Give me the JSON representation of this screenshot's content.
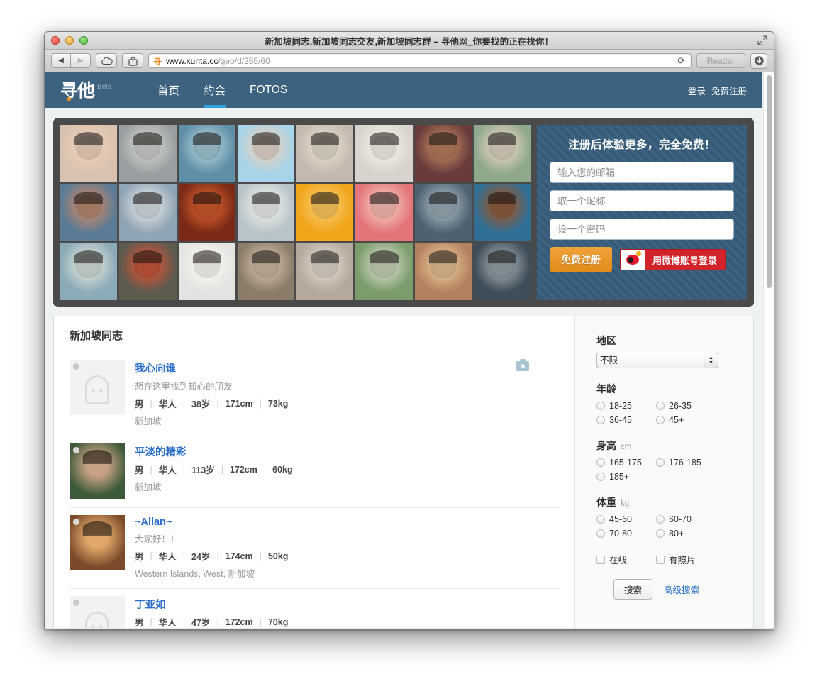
{
  "window": {
    "title": "新加坡同志,新加坡同志交友,新加坡同志群 – 寻他网_你要找的正在找你！",
    "traffic_lights": [
      "close",
      "minimize",
      "zoom"
    ],
    "fullscreen_icon": "fullscreen-icon"
  },
  "toolbar": {
    "back_icon": "back-arrow-icon",
    "forward_icon": "forward-arrow-icon",
    "icloud_icon": "icloud-tabs-icon",
    "share_icon": "share-icon",
    "favicon": "site-favicon",
    "url_domain": "www.xunta.cc",
    "url_path": "/geo/d/255/60",
    "reload_icon": "reload-icon",
    "reader_label": "Reader",
    "downloads_icon": "downloads-icon"
  },
  "nav": {
    "logo_text": "寻他",
    "logo_beta": "Beta",
    "links": [
      {
        "label": "首页",
        "active": false
      },
      {
        "label": "约会",
        "active": true
      },
      {
        "label": "FOTOS",
        "active": false
      }
    ],
    "login_label": "登录",
    "register_label": "免费注册"
  },
  "hero": {
    "photo_count": 24,
    "photos": [
      {
        "name": "member-photo-1",
        "c1": "#d9c3b0",
        "c2": "#e8cdb8"
      },
      {
        "name": "member-photo-2",
        "c1": "#9aa0a2",
        "c2": "#c6c9c4"
      },
      {
        "name": "member-photo-3",
        "c1": "#5e8fa6",
        "c2": "#9fc3cf"
      },
      {
        "name": "member-photo-4",
        "c1": "#a7d4e8",
        "c2": "#ded0c4"
      },
      {
        "name": "member-photo-5",
        "c1": "#c4b9ae",
        "c2": "#e0d6c9"
      },
      {
        "name": "member-photo-6",
        "c1": "#d8d4cd",
        "c2": "#efeae2"
      },
      {
        "name": "member-photo-7",
        "c1": "#6a3b3b",
        "c2": "#b07a5a"
      },
      {
        "name": "member-photo-8",
        "c1": "#8fa98d",
        "c2": "#d9cdbc"
      },
      {
        "name": "member-photo-9",
        "c1": "#5c7b96",
        "c2": "#b4856e"
      },
      {
        "name": "member-photo-10",
        "c1": "#8fa4b4",
        "c2": "#cfd8dd"
      },
      {
        "name": "member-photo-11",
        "c1": "#7a2a16",
        "c2": "#c8562a"
      },
      {
        "name": "member-photo-12",
        "c1": "#b8c4c9",
        "c2": "#e4e7e4"
      },
      {
        "name": "member-photo-13",
        "c1": "#f0a51a",
        "c2": "#f7c35a"
      },
      {
        "name": "member-photo-14",
        "c1": "#e2747a",
        "c2": "#f2b7ae"
      },
      {
        "name": "member-photo-15",
        "c1": "#4f6170",
        "c2": "#94a6b0"
      },
      {
        "name": "member-photo-16",
        "c1": "#2f6f96",
        "c2": "#8a5a3a"
      },
      {
        "name": "member-photo-17",
        "c1": "#8cabb8",
        "c2": "#cfd9d4"
      },
      {
        "name": "member-photo-18",
        "c1": "#5d5a4e",
        "c2": "#c2543a"
      },
      {
        "name": "member-photo-19",
        "c1": "#e3e3e1",
        "c2": "#f5f3ef"
      },
      {
        "name": "member-photo-20",
        "c1": "#8c7d6b",
        "c2": "#c4b39c"
      },
      {
        "name": "member-photo-21",
        "c1": "#b5a89c",
        "c2": "#d9cec3"
      },
      {
        "name": "member-photo-22",
        "c1": "#7c9c6c",
        "c2": "#c2cdb4"
      },
      {
        "name": "member-photo-23",
        "c1": "#b4815e",
        "c2": "#ddb98e"
      },
      {
        "name": "member-photo-24",
        "c1": "#3f4d58",
        "c2": "#8e9aa2"
      }
    ],
    "signup": {
      "title": "注册后体验更多，完全免费！",
      "email_placeholder": "输入您的邮箱",
      "email_value": "",
      "nickname_placeholder": "取一个昵称",
      "nickname_value": "",
      "password_placeholder": "设一个密码",
      "password_value": "",
      "register_button": "免费注册",
      "weibo_button": "用微博账号登录",
      "weibo_icon": "weibo-logo-icon"
    }
  },
  "results": {
    "title": "新加坡同志",
    "rows": [
      {
        "name": "我心向谁",
        "tagline": "想在这里找到知心的朋友",
        "gender": "男",
        "ethnicity": "华人",
        "age": "38岁",
        "height": "171cm",
        "weight": "73kg",
        "location": "新加坡",
        "has_photo": false,
        "online": false,
        "camera_badge": true
      },
      {
        "name": "平淡的精彩",
        "tagline": "",
        "gender": "男",
        "ethnicity": "华人",
        "age": "113岁",
        "height": "172cm",
        "weight": "60kg",
        "location": "新加坡",
        "has_photo": true,
        "online": true,
        "camera_badge": false
      },
      {
        "name": "~Allan~",
        "tagline": "大家好！！",
        "gender": "男",
        "ethnicity": "华人",
        "age": "24岁",
        "height": "174cm",
        "weight": "50kg",
        "location": "Western Islands, West, 新加坡",
        "has_photo": true,
        "online": true,
        "camera_badge": false
      },
      {
        "name": "丁亚如",
        "tagline": "",
        "gender": "男",
        "ethnicity": "华人",
        "age": "47岁",
        "height": "172cm",
        "weight": "70kg",
        "location": "",
        "has_photo": false,
        "online": false,
        "camera_badge": false
      }
    ]
  },
  "filters": {
    "region_label": "地区",
    "region_value": "不限",
    "age_label": "年龄",
    "age_options": [
      "18-25",
      "26-35",
      "36-45",
      "45+"
    ],
    "height_label": "身高",
    "height_unit": "cm",
    "height_options": [
      "165-175",
      "176-185",
      "185+"
    ],
    "weight_label": "体重",
    "weight_unit": "kg",
    "weight_options": [
      "45-60",
      "60-70",
      "70-80",
      "80+"
    ],
    "checkbox_online": "在线",
    "checkbox_photo": "有照片",
    "search_button": "搜索",
    "advanced_link": "高级搜索"
  },
  "colors": {
    "nav_bg": "#3c6280",
    "accent_blue": "#2f9fe0",
    "link_blue": "#2a6fc9",
    "orange": "#e08a18",
    "weibo_red": "#d2222a",
    "hero_bg": "#4a4a4a",
    "page_bg": "#eef2f3"
  }
}
